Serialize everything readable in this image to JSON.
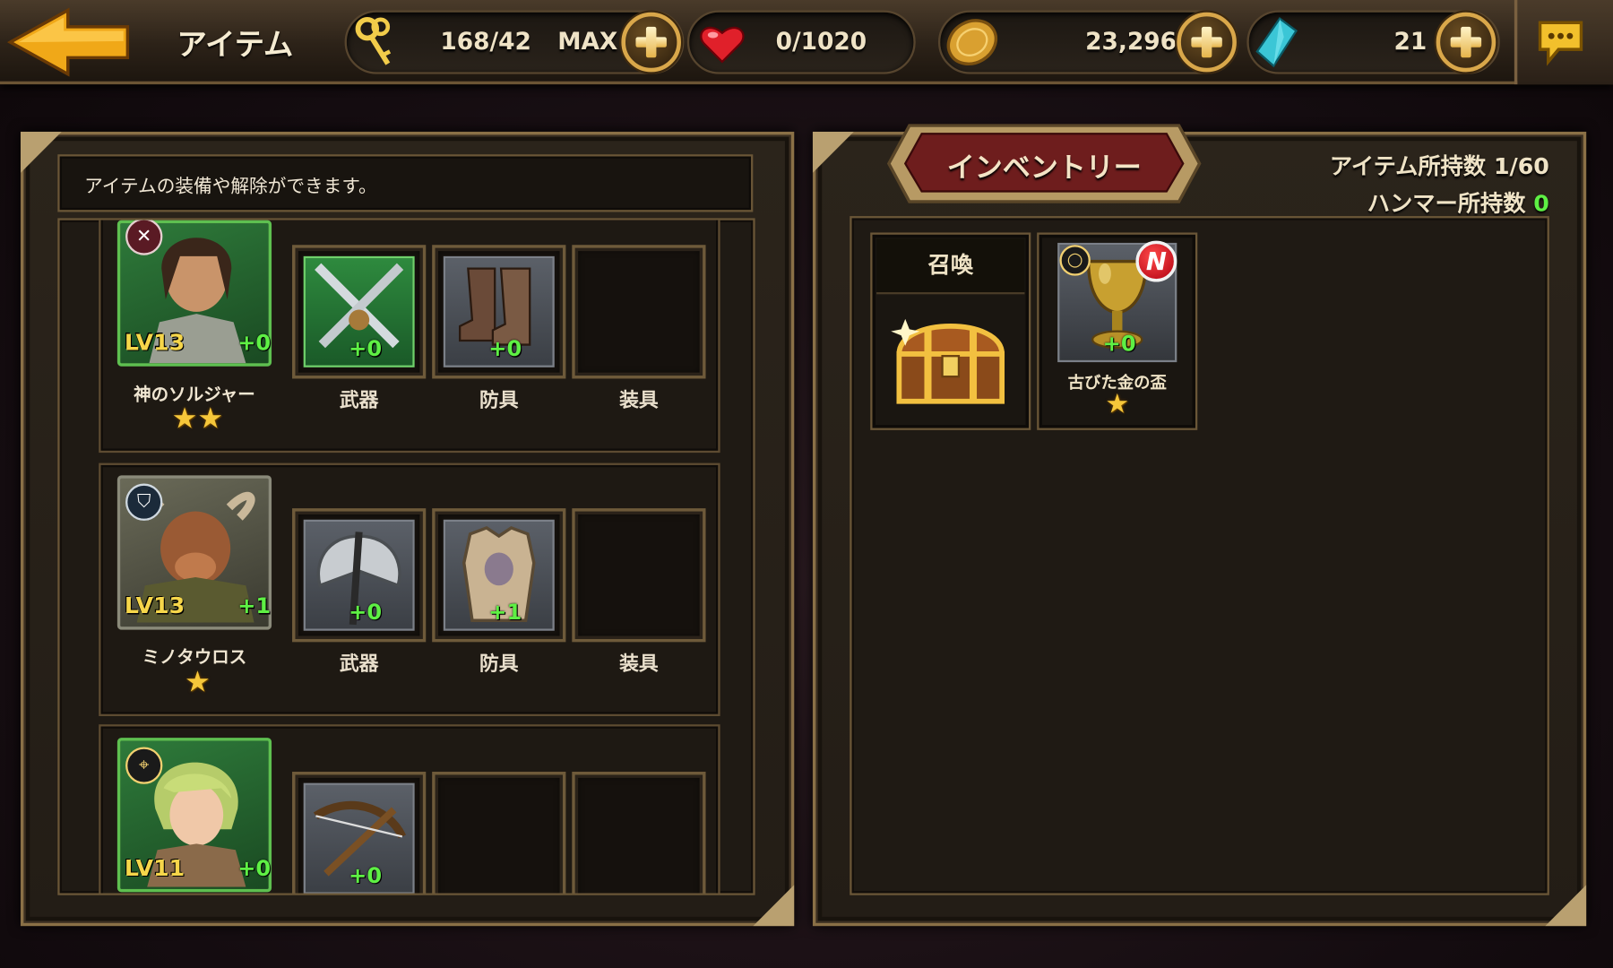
{
  "topbar": {
    "title": "アイテム",
    "keys_value": "168/42",
    "keys_max": "MAX",
    "hearts_value": "0/1020",
    "gold_value": "23,296",
    "gems_value": "21"
  },
  "left_panel": {
    "description": "アイテムの装備や解除ができます。",
    "heroes": [
      {
        "name": "神のソルジャー",
        "level": "LV13",
        "plus": "+0",
        "stars": "★★",
        "slots": [
          {
            "label": "武器",
            "plus": "+0"
          },
          {
            "label": "防具",
            "plus": "+0"
          },
          {
            "label": "装具",
            "plus": ""
          }
        ]
      },
      {
        "name": "ミノタウロス",
        "level": "LV13",
        "plus": "+1",
        "stars": "★",
        "slots": [
          {
            "label": "武器",
            "plus": "+0"
          },
          {
            "label": "防具",
            "plus": "+1"
          },
          {
            "label": "装具",
            "plus": ""
          }
        ]
      },
      {
        "name": "",
        "level": "LV11",
        "plus": "+0",
        "stars": "",
        "slots": [
          {
            "label": "",
            "plus": "+0"
          },
          {
            "label": "",
            "plus": ""
          },
          {
            "label": "",
            "plus": ""
          }
        ]
      }
    ]
  },
  "right_panel": {
    "tab_label": "インベントリー",
    "item_count_label": "アイテム所持数 1/60",
    "hammer_label": "ハンマー所持数",
    "hammer_value": "0",
    "summon_label": "召喚",
    "item": {
      "name": "古びた金の盃",
      "plus": "+0",
      "badge": "N",
      "stars": "★"
    }
  },
  "colors": {
    "accent_gold": "#d9a74a",
    "plus_green": "#5ef044",
    "level_yellow": "#f6d64a",
    "tab_red": "#6e1d1d"
  },
  "icons": [
    "back-arrow-icon",
    "key-icon",
    "heart-icon",
    "gold-coin-icon",
    "gem-icon",
    "chat-icon",
    "plus-icon",
    "close-swords-icon",
    "shield-icon",
    "crosshair-icon",
    "treasure-chest-icon",
    "golden-cup-icon"
  ]
}
